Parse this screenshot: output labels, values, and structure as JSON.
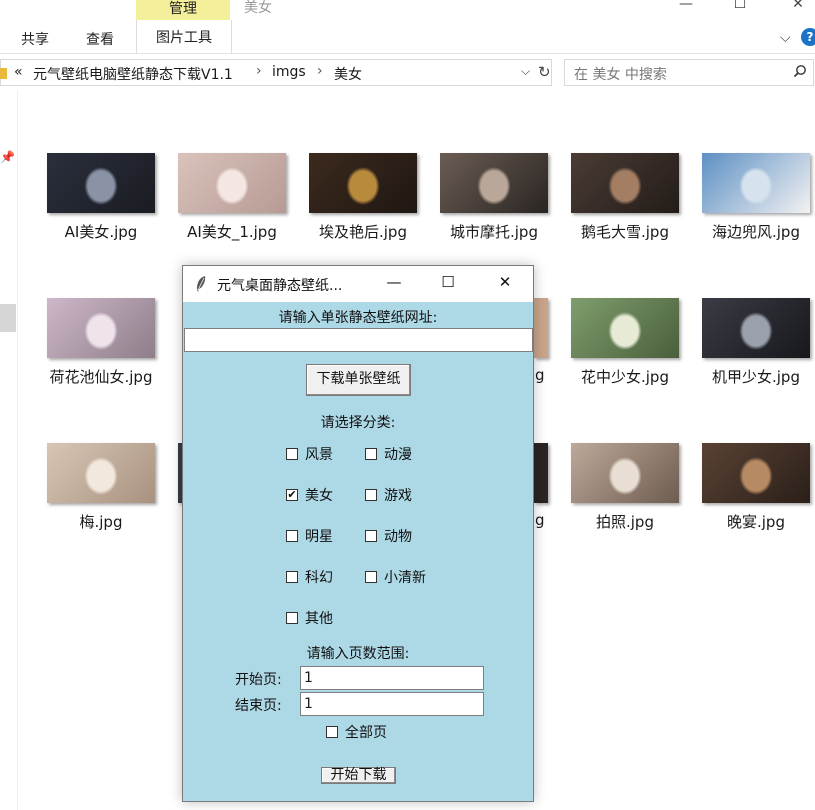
{
  "ribbon": {
    "context_group": "管理",
    "folder_title": "美女",
    "tabs": [
      "共享",
      "查看"
    ],
    "context_tab": "图片工具",
    "window_controls": [
      "—",
      "☐",
      "✕"
    ]
  },
  "address": {
    "overflow": "«",
    "path": [
      "元气壁纸电脑壁纸静态下载V1.1",
      "imgs",
      "美女"
    ],
    "separator": "›"
  },
  "search": {
    "placeholder": "在 美女 中搜索"
  },
  "files": [
    {
      "name": "AI美女.jpg",
      "colors": [
        "#2b2f3c",
        "#8a93a6",
        "#1a1c22"
      ]
    },
    {
      "name": "AI美女_1.jpg",
      "colors": [
        "#d9c3bc",
        "#f3e6e3",
        "#b79a94"
      ]
    },
    {
      "name": "埃及艳后.jpg",
      "colors": [
        "#3c2a1e",
        "#b88a3c",
        "#1f1712"
      ]
    },
    {
      "name": "城市摩托.jpg",
      "colors": [
        "#6b5d55",
        "#b9a89a",
        "#2a2522"
      ]
    },
    {
      "name": "鹅毛大雪.jpg",
      "colors": [
        "#4a3c35",
        "#a37e63",
        "#231c18"
      ]
    },
    {
      "name": "海边兜风.jpg",
      "colors": [
        "#5d8fc4",
        "#d6e3ee",
        "#f2f2f2"
      ]
    },
    {
      "name": "荷花池仙女.jpg",
      "colors": [
        "#cdb8c9",
        "#efe3ec",
        "#8f7d89"
      ]
    },
    {
      "name": "花中少女.jpg",
      "colors": [
        "#7f9e6c",
        "#e7ead5",
        "#4a5f3c"
      ]
    },
    {
      "name": "机甲少女.jpg",
      "colors": [
        "#3a3c45",
        "#9aa1ad",
        "#17181c"
      ]
    },
    {
      "name": "梅.jpg",
      "colors": [
        "#d8c6b5",
        "#f2e8de",
        "#a8927f"
      ]
    },
    {
      "name": "拍照.jpg",
      "colors": [
        "#bda99a",
        "#e9ded4",
        "#6e5c50"
      ]
    },
    {
      "name": "晚宴.jpg",
      "colors": [
        "#5a4234",
        "#b68a63",
        "#2a1f19"
      ]
    }
  ],
  "dialog": {
    "title": "元气桌面静态壁纸...",
    "url_prompt": "请输入单张静态壁纸网址:",
    "url_value": "",
    "download_single": "下载单张壁纸",
    "category_prompt": "请选择分类:",
    "categories": [
      {
        "label": "风景",
        "checked": false
      },
      {
        "label": "动漫",
        "checked": false
      },
      {
        "label": "美女",
        "checked": true
      },
      {
        "label": "游戏",
        "checked": false
      },
      {
        "label": "明星",
        "checked": false
      },
      {
        "label": "动物",
        "checked": false
      },
      {
        "label": "科幻",
        "checked": false
      },
      {
        "label": "小清新",
        "checked": false
      },
      {
        "label": "其他",
        "checked": false
      }
    ],
    "page_range_prompt": "请输入页数范围:",
    "start_label": "开始页:",
    "start_value": "1",
    "end_label": "结束页:",
    "end_value": "1",
    "all_pages_label": "全部页",
    "all_pages_checked": false,
    "start_button": "开始下载",
    "background": "#add8e6"
  },
  "background_partial_labels": [
    "g",
    "g",
    "g"
  ]
}
